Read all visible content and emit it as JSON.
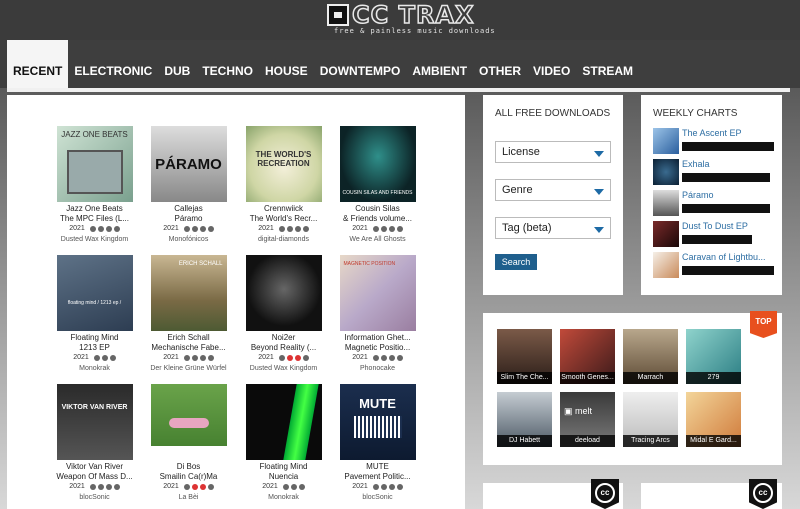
{
  "header": {
    "logo_text": "CC TRAX",
    "tagline": "free & painless music downloads"
  },
  "nav": [
    "RECENT",
    "ELECTRONIC",
    "DUB",
    "TECHNO",
    "HOUSE",
    "DOWNTEMPO",
    "AMBIENT",
    "OTHER",
    "VIDEO",
    "STREAM"
  ],
  "albums": [
    {
      "artist": "Jazz One Beats",
      "title": "The MPC Files (L...",
      "year": "2021",
      "label": "Dusted Wax Kingdom",
      "cover_text": "JAZZ ONE BEATS"
    },
    {
      "artist": "Callejas",
      "title": "Páramo",
      "year": "2021",
      "label": "Monofónicos",
      "cover_text": "PÁRAMO"
    },
    {
      "artist": "Crennwiick",
      "title": "The World's Recr...",
      "year": "2021",
      "label": "digital-diamonds",
      "cover_text": "THE WORLD'S RECREATION"
    },
    {
      "artist": "Cousin Silas",
      "title": "& Friends volume...",
      "year": "2021",
      "label": "We Are All Ghosts",
      "cover_text": "COUSIN SILAS AND FRIENDS"
    },
    {
      "artist": "Floating Mind",
      "title": "1213 EP",
      "year": "2021",
      "label": "Monokrak",
      "cover_text": "floating mind / 1213 ep /"
    },
    {
      "artist": "Erich Schall",
      "title": "Mechanische Fabe...",
      "year": "2021",
      "label": "Der Kleine Grüne Würfel",
      "cover_text": "ERICH SCHALL"
    },
    {
      "artist": "Noi2er",
      "title": "Beyond Reality (...",
      "year": "2021",
      "label": "Dusted Wax Kingdom",
      "cover_text": ""
    },
    {
      "artist": "Information Ghet...",
      "title": "Magnetic Positio...",
      "year": "2021",
      "label": "Phonocake",
      "cover_text": "MAGNETIC POSITION"
    },
    {
      "artist": "Viktor Van River",
      "title": "Weapon Of Mass D...",
      "year": "2021",
      "label": "blocSonic",
      "cover_text": "VIKTOR VAN RIVER"
    },
    {
      "artist": "Di Bos",
      "title": "Smailin Ca(r)Ma",
      "year": "2021",
      "label": "La Bèi",
      "cover_text": ""
    },
    {
      "artist": "Floating Mind",
      "title": "Nuencia",
      "year": "2021",
      "label": "Monokrak",
      "cover_text": ""
    },
    {
      "artist": "MUTE",
      "title": "Pavement Politic...",
      "year": "2021",
      "label": "blocSonic",
      "cover_text": "MUTE"
    }
  ],
  "search": {
    "title": "ALL FREE DOWNLOADS",
    "selects": [
      "License",
      "Genre",
      "Tag (beta)"
    ],
    "button": "Search"
  },
  "charts": {
    "title": "WEEKLY CHARTS",
    "items": [
      "The Ascent EP",
      "Exhala",
      "Páramo",
      "Dust To Dust EP",
      "Caravan of Lightbu..."
    ]
  },
  "top": {
    "badge": "TOP",
    "tiles": [
      "Slim The Che...",
      "Smooth Genes...",
      "Marrach",
      "279",
      "DJ Habett",
      "deeload",
      "Tracing Arcs",
      "Midal E Gard..."
    ]
  },
  "cc_badge": "cc",
  "colors": {
    "accent_blue": "#1f5f8d",
    "top_orange": "#e8501e",
    "link_blue": "#2d6ea3"
  }
}
